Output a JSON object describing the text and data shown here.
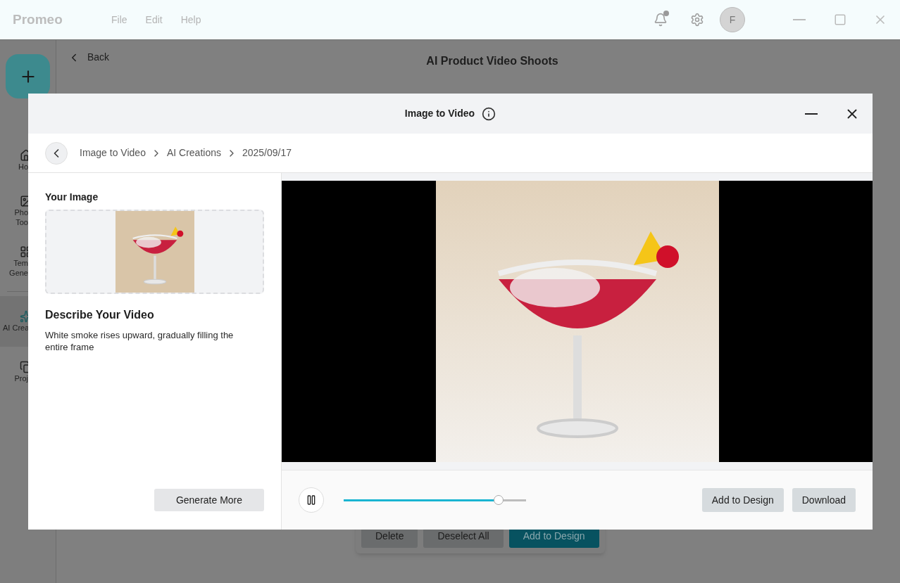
{
  "app": {
    "name": "Promeo",
    "menu": [
      "File",
      "Edit",
      "Help"
    ],
    "avatar": "F",
    "notification_dot": true
  },
  "sidebar": {
    "items": [
      {
        "kind": "home",
        "lines": [
          "Ho"
        ],
        "selected": false
      },
      {
        "kind": "photo",
        "lines": [
          "Pho",
          "Too"
        ],
        "selected": false
      },
      {
        "kind": "template",
        "lines": [
          "Tem",
          "Gene"
        ],
        "selected": false
      },
      {
        "kind": "ai",
        "lines": [
          "AI Crea"
        ],
        "selected": true
      },
      {
        "kind": "projects",
        "lines": [
          "Proj"
        ],
        "selected": false
      }
    ]
  },
  "page": {
    "back": "Back",
    "title": "AI Product Video Shoots",
    "actions": [
      {
        "label": "Delete",
        "kind": "plain"
      },
      {
        "label": "Deselect All",
        "kind": "plain"
      },
      {
        "label": "Add to Design",
        "kind": "primary"
      }
    ]
  },
  "dialog": {
    "title": "Image to Video",
    "breadcrumb": [
      "Image to Video",
      "AI Creations",
      "2025/09/17"
    ],
    "image_label": "Your Image",
    "describe_label": "Describe Your Video",
    "description": "White smoke rises upward, gradually filling the entire frame",
    "generate_button": "Generate More",
    "player": {
      "playing": true,
      "level": 0.85
    },
    "buttons": [
      "Add to Design",
      "Download"
    ]
  }
}
